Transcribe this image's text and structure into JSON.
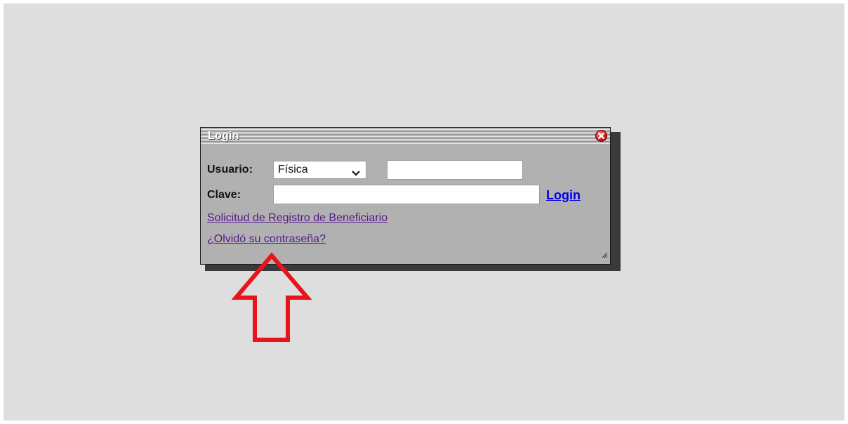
{
  "dialog": {
    "title": "Login",
    "usuario_label": "Usuario:",
    "usuario_type_selected": "Física",
    "usuario_value": "",
    "clave_label": "Clave:",
    "clave_value": "",
    "login_label": "Login",
    "register_link": "Solicitud de Registro de Beneficiario",
    "forgot_link": "¿Olvidó su contraseña?"
  },
  "icons": {
    "close": "close-icon",
    "dropdown": "chevron-down-icon",
    "resize": "resize-grip-icon",
    "annotation": "up-arrow-annotation"
  },
  "colors": {
    "background": "#dedede",
    "dialog": "#b1b1b1",
    "link_visited": "#551a8b",
    "link_action": "#0000ee",
    "annotation": "#e8141c"
  }
}
